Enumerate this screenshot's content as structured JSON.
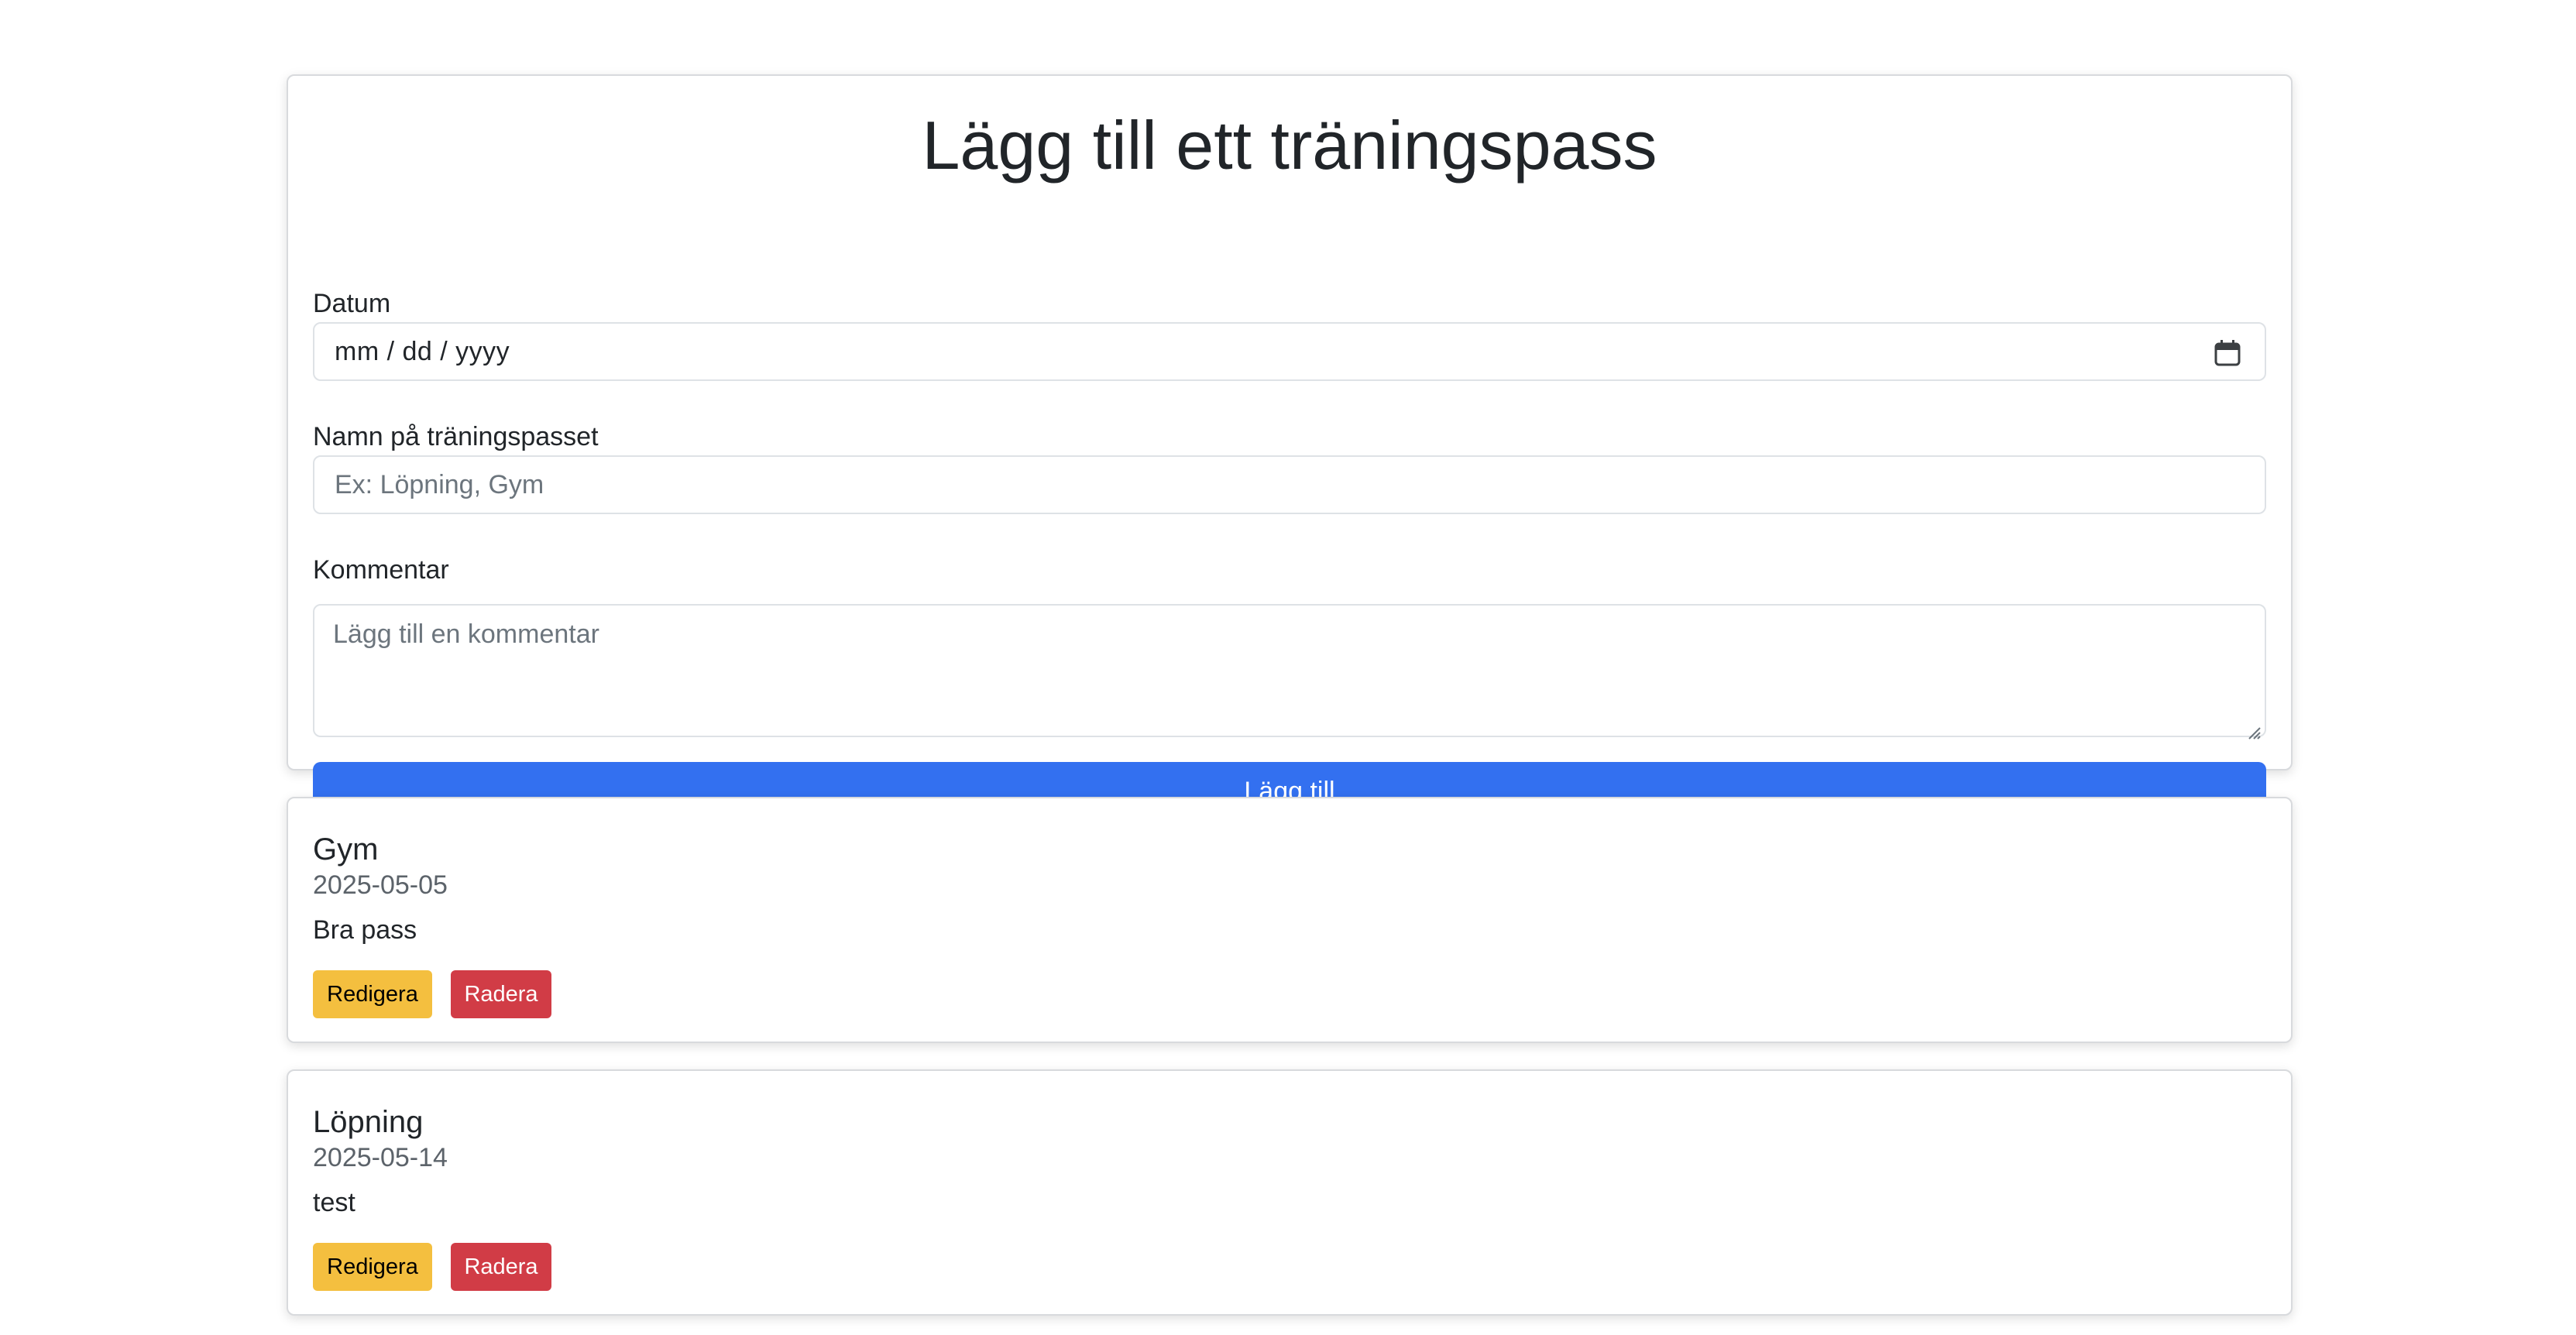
{
  "form": {
    "title": "Lägg till ett träningspass",
    "date_label": "Datum",
    "date_value": "mm / dd / yyyy",
    "name_label": "Namn på träningspasset",
    "name_placeholder": "Ex: Löpning, Gym",
    "comment_label": "Kommentar",
    "comment_placeholder": "Lägg till en kommentar",
    "submit_label": "Lägg till"
  },
  "workouts": [
    {
      "name": "Gym",
      "date": "2025-05-05",
      "comment": "Bra pass",
      "edit_label": "Redigera",
      "delete_label": "Radera"
    },
    {
      "name": "Löpning",
      "date": "2025-05-14",
      "comment": "test",
      "edit_label": "Redigera",
      "delete_label": "Radera"
    }
  ],
  "colors": {
    "primary": "#3370f0",
    "warning": "#f4bf3f",
    "danger": "#d13c46"
  }
}
